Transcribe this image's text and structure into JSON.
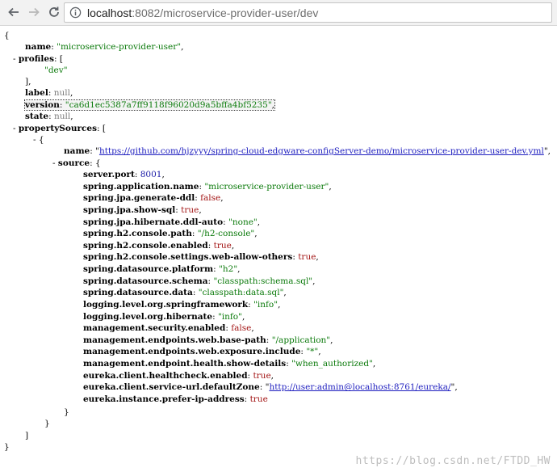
{
  "browser": {
    "url_host": "localhost",
    "url_path": ":8082/microservice-provider-user/dev"
  },
  "json": {
    "open_brace": "{",
    "close_brace": "}",
    "name_key": "name",
    "name_value": "\"microservice-provider-user\"",
    "profiles_key": "profiles",
    "profiles_open": "[",
    "profiles_item": "\"dev\"",
    "profiles_close": "],",
    "label_key": "label",
    "label_value": "null",
    "version_key": "version",
    "version_value": "\"ca6d1ec5387a7ff9118f96020d9a5bffa4bf5235\"",
    "state_key": "state",
    "state_value": "null",
    "propertySources_key": "propertySources",
    "ps_open": "[",
    "ps_item_open": "{",
    "ps_name_key": "name",
    "ps_name_value": "https://github.com/hjzyyy/spring-cloud-edgware-configServer-demo/microservice-provider-user-dev.yml",
    "source_key": "source",
    "source_open": "{",
    "source_close": "}",
    "ps_item_close": "}",
    "ps_close": "]",
    "toggle_minus": "-",
    "source": [
      {
        "key": "server.port",
        "value": "8001",
        "type": "num"
      },
      {
        "key": "spring.application.name",
        "value": "\"microservice-provider-user\"",
        "type": "str"
      },
      {
        "key": "spring.jpa.generate-ddl",
        "value": "false",
        "type": "bool"
      },
      {
        "key": "spring.jpa.show-sql",
        "value": "true",
        "type": "bool"
      },
      {
        "key": "spring.jpa.hibernate.ddl-auto",
        "value": "\"none\"",
        "type": "str"
      },
      {
        "key": "spring.h2.console.path",
        "value": "\"/h2-console\"",
        "type": "str"
      },
      {
        "key": "spring.h2.console.enabled",
        "value": "true",
        "type": "bool"
      },
      {
        "key": "spring.h2.console.settings.web-allow-others",
        "value": "true",
        "type": "bool"
      },
      {
        "key": "spring.datasource.platform",
        "value": "\"h2\"",
        "type": "str"
      },
      {
        "key": "spring.datasource.schema",
        "value": "\"classpath:schema.sql\"",
        "type": "str"
      },
      {
        "key": "spring.datasource.data",
        "value": "\"classpath:data.sql\"",
        "type": "str"
      },
      {
        "key": "logging.level.org.springframework",
        "value": "\"info\"",
        "type": "str"
      },
      {
        "key": "logging.level.org.hibernate",
        "value": "\"info\"",
        "type": "str"
      },
      {
        "key": "management.security.enabled",
        "value": "false",
        "type": "bool"
      },
      {
        "key": "management.endpoints.web.base-path",
        "value": "\"/application\"",
        "type": "str"
      },
      {
        "key": "management.endpoints.web.exposure.include",
        "value": "\"*\"",
        "type": "str"
      },
      {
        "key": "management.endpoint.health.show-details",
        "value": "\"when_authorized\"",
        "type": "str"
      },
      {
        "key": "eureka.client.healthcheck.enabled",
        "value": "true",
        "type": "bool"
      },
      {
        "key": "eureka.client.service-url.defaultZone",
        "value": "http://user:admin@localhost:8761/eureka/",
        "type": "link"
      },
      {
        "key": "eureka.instance.prefer-ip-address",
        "value": "true",
        "type": "bool"
      }
    ]
  },
  "watermark": "https://blog.csdn.net/FTDD_HW",
  "colors": {
    "string": "#0b7a0b",
    "number": "#1a1aa6",
    "boolean": "#a31515",
    "null": "#7a7a7a",
    "link": "#1f1fbf"
  }
}
